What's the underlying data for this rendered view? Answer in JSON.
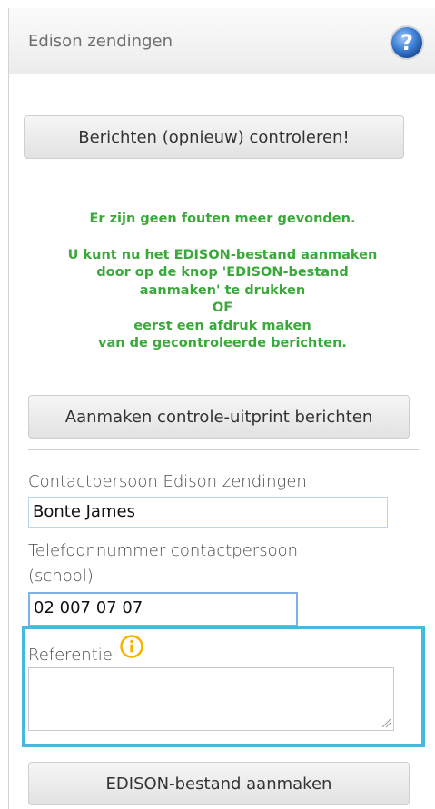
{
  "header": {
    "title": "Edison zendingen",
    "help_icon": "help-icon"
  },
  "buttons": {
    "check_messages": "Berichten (opnieuw) controleren!",
    "print_control": "Aanmaken controle-uitprint berichten",
    "create_file": "EDISON-bestand aanmaken"
  },
  "message": {
    "line1": "Er zijn geen fouten meer gevonden.",
    "line2": "U kunt nu het EDISON-bestand aanmaken",
    "line3": "door op de knop 'EDISON-bestand",
    "line4": "aanmaken' te drukken",
    "line5": "OF",
    "line6": "eerst een afdruk maken",
    "line7": "van de gecontroleerde berichten."
  },
  "form": {
    "contact_label": "Contactpersoon Edison zendingen",
    "contact_value": "Bonte James",
    "phone_label_1": "Telefoonnummer contactpersoon",
    "phone_label_2": "(school)",
    "phone_value": "02 007 07 07",
    "reference_label": "Referentie",
    "reference_value": "",
    "info_icon": "info-icon"
  },
  "colors": {
    "success_text": "#3aa93a",
    "highlight_border": "#48b8de",
    "help_icon": "#3b7fd4",
    "info_icon": "#f5b400"
  }
}
